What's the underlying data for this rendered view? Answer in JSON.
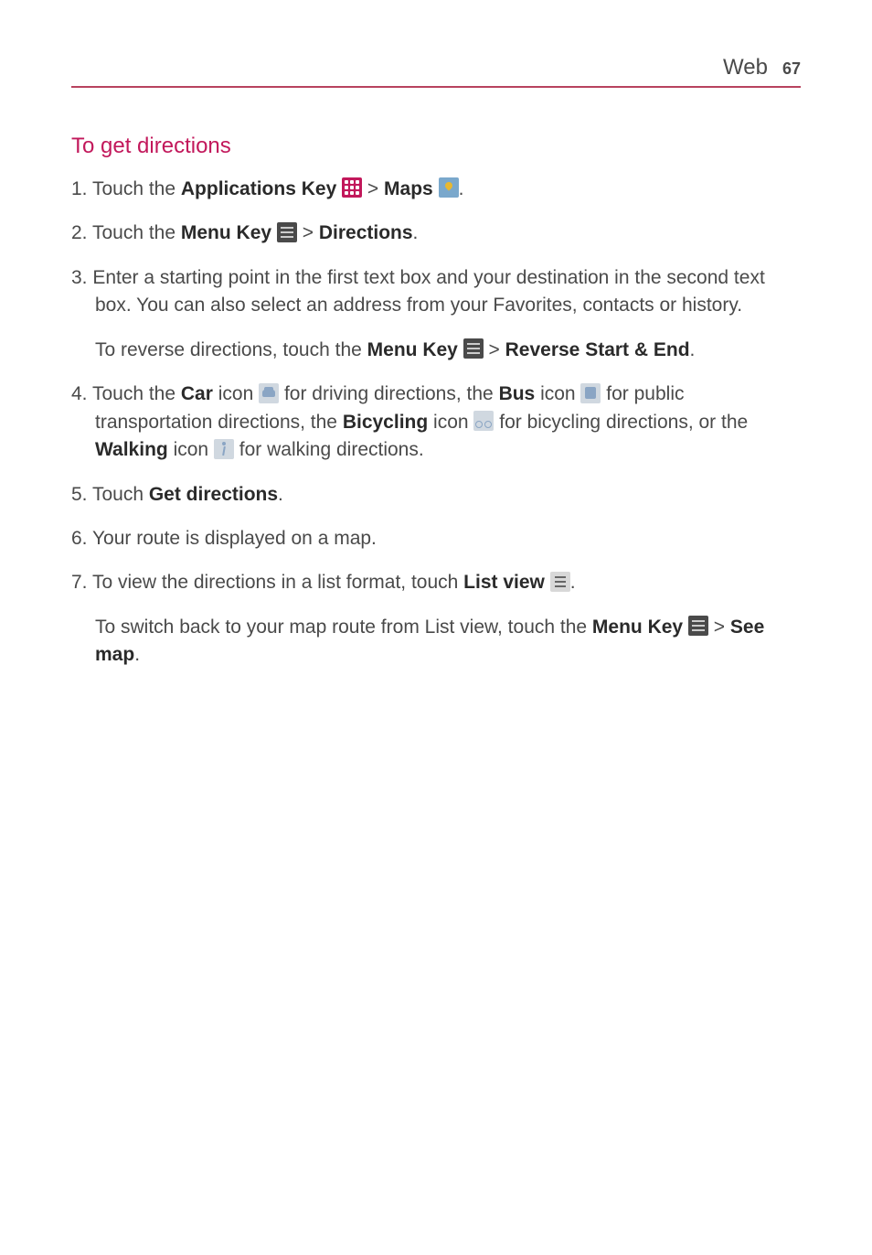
{
  "header": {
    "section": "Web",
    "page": "67"
  },
  "title": "To get directions",
  "steps": {
    "s1": {
      "num": "1.",
      "t1": " Touch the ",
      "b1": "Applications Key",
      "t2": " ",
      "gt1": " > ",
      "b2": "Maps",
      "end": "."
    },
    "s2": {
      "num": "2.",
      "t1": " Touch the ",
      "b1": "Menu Key",
      "gt1": " > ",
      "b2": "Directions",
      "end": "."
    },
    "s3": {
      "num": "3.",
      "t1": " Enter a starting point in the first text box and your destination in the second text box. You can also select an address from your Favorites, contacts or history.",
      "sub_t1": "To reverse directions, touch the ",
      "sub_b1": "Menu Key",
      "sub_gt1": " > ",
      "sub_b2": "Reverse Start & End",
      "sub_end": "."
    },
    "s4": {
      "num": "4.",
      "t1": " Touch the ",
      "b1": "Car",
      "t2": " icon ",
      "t3": " for driving directions, the ",
      "b2": "Bus",
      "t4": " icon ",
      "t5": " for public transportation directions, the ",
      "b3": "Bicycling",
      "t6": " icon ",
      "t7": " for bicycling directions, or the ",
      "b4": "Walking",
      "t8": " icon ",
      "t9": " for walking directions."
    },
    "s5": {
      "num": "5.",
      "t1": " Touch ",
      "b1": "Get directions",
      "end": "."
    },
    "s6": {
      "num": "6.",
      "t1": " Your route is displayed on a map."
    },
    "s7": {
      "num": "7.",
      "t1": " To view the directions in a list format, touch ",
      "b1": "List view",
      "end": ".",
      "sub_t1": "To switch back to your map route from List view, touch the ",
      "sub_b1": "Menu Key",
      "sub_gt1": " > ",
      "sub_b2": "See map",
      "sub_end": "."
    }
  }
}
